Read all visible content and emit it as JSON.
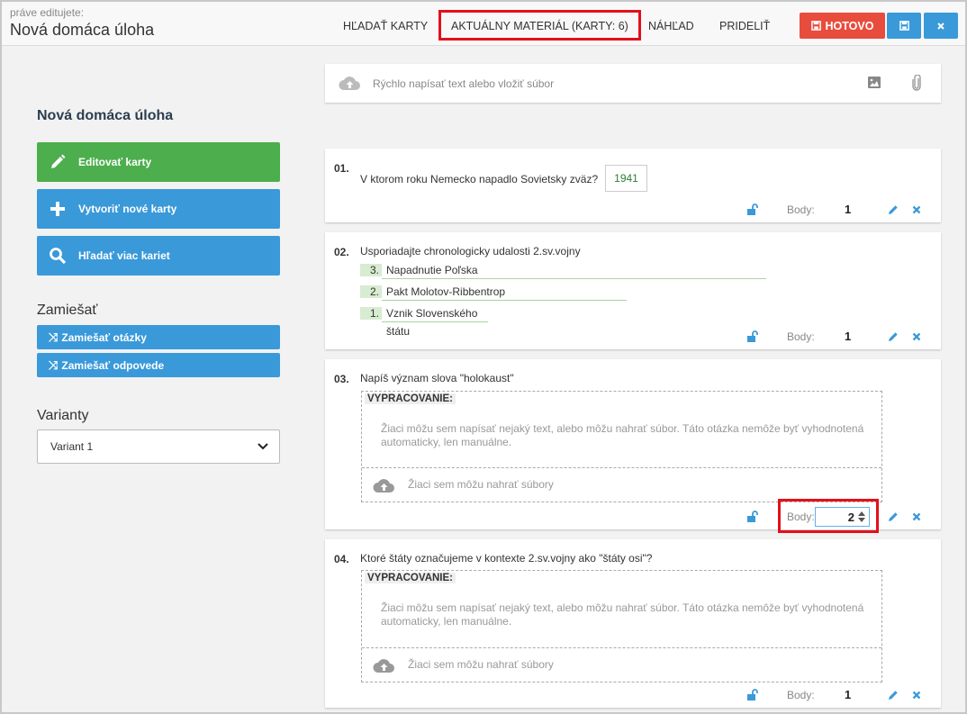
{
  "header": {
    "editing_label": "práve editujete:",
    "doc_title": "Nová domáca úloha",
    "tabs": [
      {
        "label": "HĽADAŤ KARTY"
      },
      {
        "label": "AKTUÁLNY MATERIÁL (KARTY: 6)"
      },
      {
        "label": "NÁHĽAD"
      },
      {
        "label": "PRIDELIŤ"
      }
    ],
    "done_label": "HOTOVO"
  },
  "sidebar": {
    "title": "Nová domáca úloha",
    "actions": [
      {
        "label": "Editovať karty",
        "color": "#4cae4c"
      },
      {
        "label": "Vytvoriť nové karty",
        "color": "#3a99d9"
      },
      {
        "label": "Hľadať viac kariet",
        "color": "#3a99d9"
      }
    ],
    "shuffle_heading": "Zamiešať",
    "shuffle": [
      {
        "label": "Zamiešať otázky"
      },
      {
        "label": "Zamiešať odpovede"
      }
    ],
    "variants_heading": "Varianty",
    "variant_selected": "Variant 1"
  },
  "quick_input": {
    "placeholder": "Rýchlo napísať text alebo vložiť súbor"
  },
  "cards": [
    {
      "number": "01.",
      "question": "V ktorom roku Nemecko napadlo Sovietsky zväz?",
      "answer": "1941",
      "points_label": "Body:",
      "points": "1"
    },
    {
      "number": "02.",
      "question": "Usporiadajte chronologicky udalosti 2.sv.vojny",
      "items": [
        {
          "order": "3.",
          "text": "Napadnutie Poľska"
        },
        {
          "order": "2.",
          "text": "Pakt Molotov-Ribbentrop"
        },
        {
          "order": "1.",
          "text": "Vznik Slovenského štátu"
        }
      ],
      "points_label": "Body:",
      "points": "1"
    },
    {
      "number": "03.",
      "question": "Napíš význam slova \"holokaust\"",
      "essay_label": "VYPRACOVANIE:",
      "essay_hint": "Žiaci môžu sem napísať nejaký text, alebo môžu nahrať súbor. Táto otázka nemôže byť vyhodnotená automaticky, len manuálne.",
      "upload_hint": "Žiaci sem môžu nahrať súbory",
      "points_label": "Body:",
      "points": "2"
    },
    {
      "number": "04.",
      "question": "Ktoré štáty označujeme v kontexte 2.sv.vojny ako \"štáty osi\"?",
      "essay_label": "VYPRACOVANIE:",
      "essay_hint": "Žiaci môžu sem napísať nejaký text, alebo môžu nahrať súbor. Táto otázka nemôže byť vyhodnotená automaticky, len manuálne.",
      "upload_hint": "Žiaci sem môžu nahrať súbory",
      "points_label": "Body:",
      "points": "1"
    }
  ],
  "colors": {
    "accent_blue": "#3a99d9",
    "green": "#4cae4c",
    "red": "#e84c3d",
    "highlight": "#e3101c"
  }
}
